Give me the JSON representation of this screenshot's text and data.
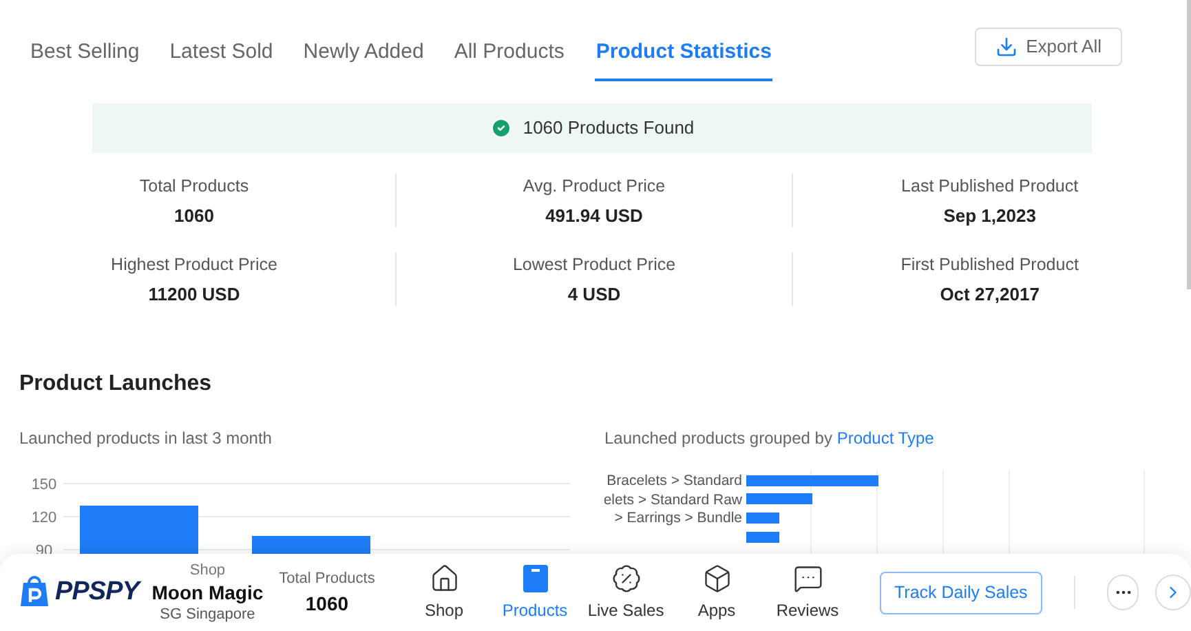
{
  "tabs": [
    {
      "label": "Best Selling",
      "selected": false
    },
    {
      "label": "Latest Sold",
      "selected": false
    },
    {
      "label": "Newly Added",
      "selected": false
    },
    {
      "label": "All Products",
      "selected": false
    },
    {
      "label": "Product Statistics",
      "selected": true
    }
  ],
  "export_button": "Export All",
  "result_banner": "1060 Products Found",
  "stats": [
    {
      "label": "Total Products",
      "value": "1060"
    },
    {
      "label": "Avg. Product Price",
      "value": "491.94 USD"
    },
    {
      "label": "Last Published Product",
      "value": "Sep 1,2023"
    },
    {
      "label": "Highest Product Price",
      "value": "11200 USD"
    },
    {
      "label": "Lowest Product Price",
      "value": "4 USD"
    },
    {
      "label": "First Published Product",
      "value": "Oct 27,2017"
    }
  ],
  "launches": {
    "title": "Product Launches",
    "left_chart": {
      "subtitle": "Launched products in last 3 month",
      "axis_labels": [
        "150",
        "120",
        "90"
      ]
    },
    "right_chart": {
      "subtitle": "Launched products grouped by",
      "subtitle_link": "Product Type",
      "labels": [
        "Bracelets > Standard",
        "elets > Standard Raw",
        "> Earrings > Bundle"
      ]
    }
  },
  "bottom_bar": {
    "logo": "PPSPY",
    "shop_caption": "Shop",
    "shop_name": "Moon Magic",
    "shop_country": "SG Singapore",
    "total_caption": "Total Products",
    "total_value": "1060",
    "nav": [
      {
        "label": "Shop",
        "selected": false
      },
      {
        "label": "Products",
        "selected": true
      },
      {
        "label": "Live Sales",
        "selected": false
      },
      {
        "label": "Apps",
        "selected": false
      },
      {
        "label": "Reviews",
        "selected": false
      }
    ],
    "track_button": "Track Daily Sales"
  }
}
